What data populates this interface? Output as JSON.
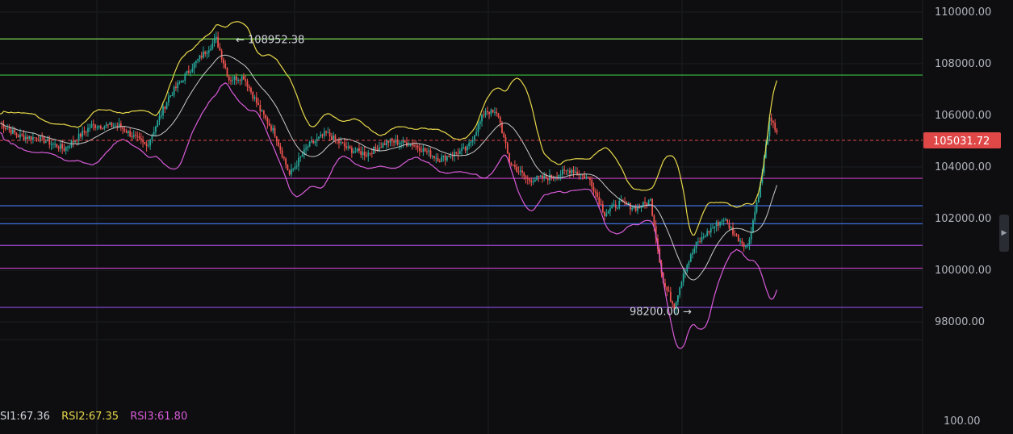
{
  "chart_data": {
    "type": "candlestick",
    "price_axis": {
      "ticks": [
        110000,
        108000,
        106000,
        104000,
        102000,
        100000,
        98000
      ],
      "tick_labels": [
        "110000.00",
        "108000.00",
        "106000.00",
        "104000.00",
        "102000.00",
        "100000.00",
        "98000.00"
      ],
      "ylim": [
        96800,
        111000
      ]
    },
    "rsi_axis": {
      "tick_labels": [
        "100.00"
      ]
    },
    "current_price": {
      "value": 105031.72,
      "label": "105031.72"
    },
    "annotations": [
      {
        "label": "108952.38",
        "value": 108952.38,
        "direction": "left"
      },
      {
        "label": "98200.00",
        "value": 98200.0,
        "direction": "right"
      }
    ],
    "horizontal_levels": [
      {
        "value": 108960,
        "color": "#7ed957"
      },
      {
        "value": 107560,
        "color": "#39c23c"
      },
      {
        "value": 103560,
        "color": "#c43fc4"
      },
      {
        "value": 102500,
        "color": "#3d6fe0"
      },
      {
        "value": 101800,
        "color": "#3d6fe0"
      },
      {
        "value": 100960,
        "color": "#a64ad8"
      },
      {
        "value": 100080,
        "color": "#c43fc4"
      },
      {
        "value": 98560,
        "color": "#8a4ae0"
      }
    ],
    "price_path": [
      {
        "i": 0,
        "p": 105700
      },
      {
        "i": 10,
        "p": 105200
      },
      {
        "i": 22,
        "p": 105100
      },
      {
        "i": 35,
        "p": 104700
      },
      {
        "i": 50,
        "p": 105600
      },
      {
        "i": 65,
        "p": 105600
      },
      {
        "i": 80,
        "p": 104800
      },
      {
        "i": 92,
        "p": 106700
      },
      {
        "i": 105,
        "p": 107900
      },
      {
        "i": 118,
        "p": 108950
      },
      {
        "i": 125,
        "p": 107400
      },
      {
        "i": 133,
        "p": 107500
      },
      {
        "i": 142,
        "p": 106200
      },
      {
        "i": 150,
        "p": 105300
      },
      {
        "i": 158,
        "p": 103700
      },
      {
        "i": 168,
        "p": 104800
      },
      {
        "i": 178,
        "p": 105300
      },
      {
        "i": 190,
        "p": 104700
      },
      {
        "i": 200,
        "p": 104500
      },
      {
        "i": 212,
        "p": 105000
      },
      {
        "i": 225,
        "p": 104900
      },
      {
        "i": 240,
        "p": 104300
      },
      {
        "i": 255,
        "p": 104700
      },
      {
        "i": 265,
        "p": 106200
      },
      {
        "i": 272,
        "p": 106000
      },
      {
        "i": 278,
        "p": 104200
      },
      {
        "i": 288,
        "p": 103500
      },
      {
        "i": 300,
        "p": 103600
      },
      {
        "i": 312,
        "p": 103900
      },
      {
        "i": 322,
        "p": 103500
      },
      {
        "i": 330,
        "p": 102200
      },
      {
        "i": 338,
        "p": 102600
      },
      {
        "i": 348,
        "p": 102400
      },
      {
        "i": 355,
        "p": 102700
      },
      {
        "i": 362,
        "p": 99500
      },
      {
        "i": 368,
        "p": 98600
      },
      {
        "i": 373,
        "p": 99900
      },
      {
        "i": 380,
        "p": 101000
      },
      {
        "i": 388,
        "p": 101600
      },
      {
        "i": 395,
        "p": 102000
      },
      {
        "i": 402,
        "p": 101300
      },
      {
        "i": 408,
        "p": 100900
      },
      {
        "i": 415,
        "p": 103300
      },
      {
        "i": 420,
        "p": 105800
      },
      {
        "i": 424,
        "p": 105400
      }
    ]
  },
  "rsi_legend": {
    "rsi1": {
      "label": "SI1:67.36",
      "color": "#d1d4dc"
    },
    "rsi2": {
      "label": "RSI2:67.35",
      "color": "#e8d84a"
    },
    "rsi3": {
      "label": "RSI3:61.80",
      "color": "#d95bd9"
    }
  },
  "colors": {
    "up": "#26a69a",
    "down": "#ef5350",
    "upper_band": "#e8d84a",
    "middle_band": "#c9c9c9",
    "lower_band": "#d95bd9",
    "price_tag": "#e04848",
    "grid": "#1c1d22"
  }
}
